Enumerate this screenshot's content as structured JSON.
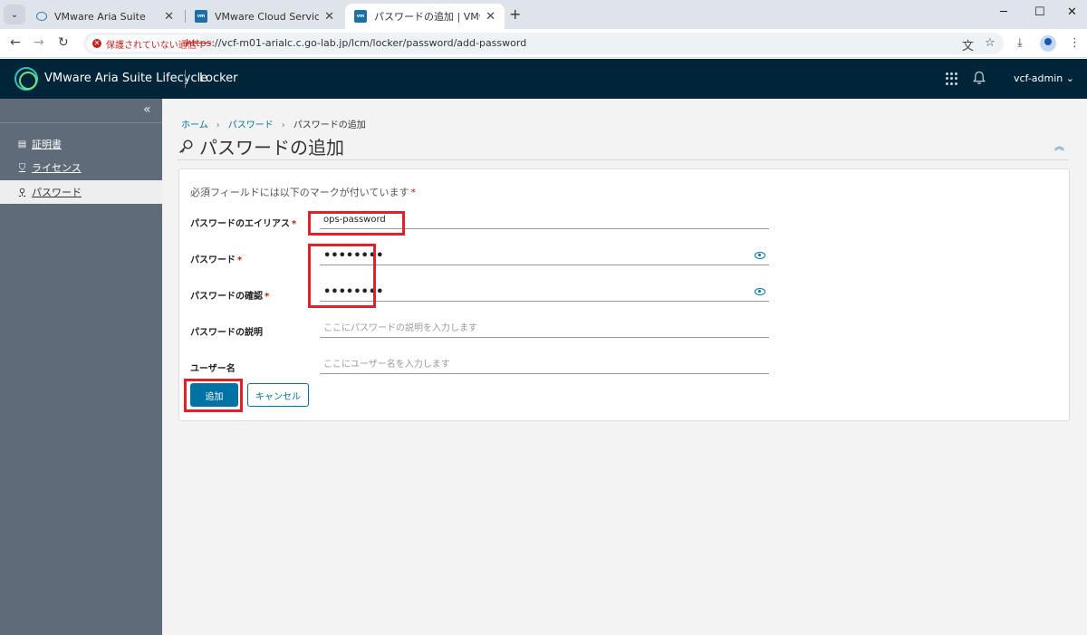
{
  "browser": {
    "tabs": [
      {
        "title": "VMware Aria Suite",
        "close": "✕"
      },
      {
        "title": "VMware Cloud Services",
        "close": "✕"
      },
      {
        "title": "パスワードの追加 | VMware Aria Suite",
        "close": "✕"
      }
    ],
    "new_tab": "+",
    "security_label": "保護されていない通信",
    "url_scheme": "https",
    "url_rest": "://vcf-m01-arialc.c.go-lab.jp/lcm/locker/password/add-password"
  },
  "header": {
    "product": "VMware Aria Suite Lifecycle",
    "section": "Locker",
    "user": "vcf-admin ⌄"
  },
  "sidebar": {
    "items": [
      {
        "label": "証明書",
        "icon": "certificate-icon"
      },
      {
        "label": "ライセンス",
        "icon": "shield-icon"
      },
      {
        "label": "パスワード",
        "icon": "key-icon"
      }
    ]
  },
  "main": {
    "breadcrumb": [
      "ホーム",
      "パスワード",
      "パスワードの追加"
    ],
    "title": "パスワードの追加",
    "required_note": "必須フィールドには以下のマークが付いています",
    "required_mark": "*",
    "fields": {
      "alias": {
        "label": "パスワードのエイリアス",
        "value": "ops-password"
      },
      "password": {
        "label": "パスワード",
        "value": "••••••••"
      },
      "confirm": {
        "label": "パスワードの確認",
        "value": "••••••••"
      },
      "description": {
        "label": "パスワードの説明",
        "placeholder": "ここにパスワードの説明を入力します"
      },
      "username": {
        "label": "ユーザー名",
        "placeholder": "ここにユーザー名を入力します"
      }
    },
    "add_button": "追加",
    "cancel_button": "キャンセル"
  },
  "colors": {
    "header_bg": "#002538",
    "sidebar_bg": "#5f6b78",
    "accent": "#0072a3",
    "highlight": "#e0202a"
  }
}
